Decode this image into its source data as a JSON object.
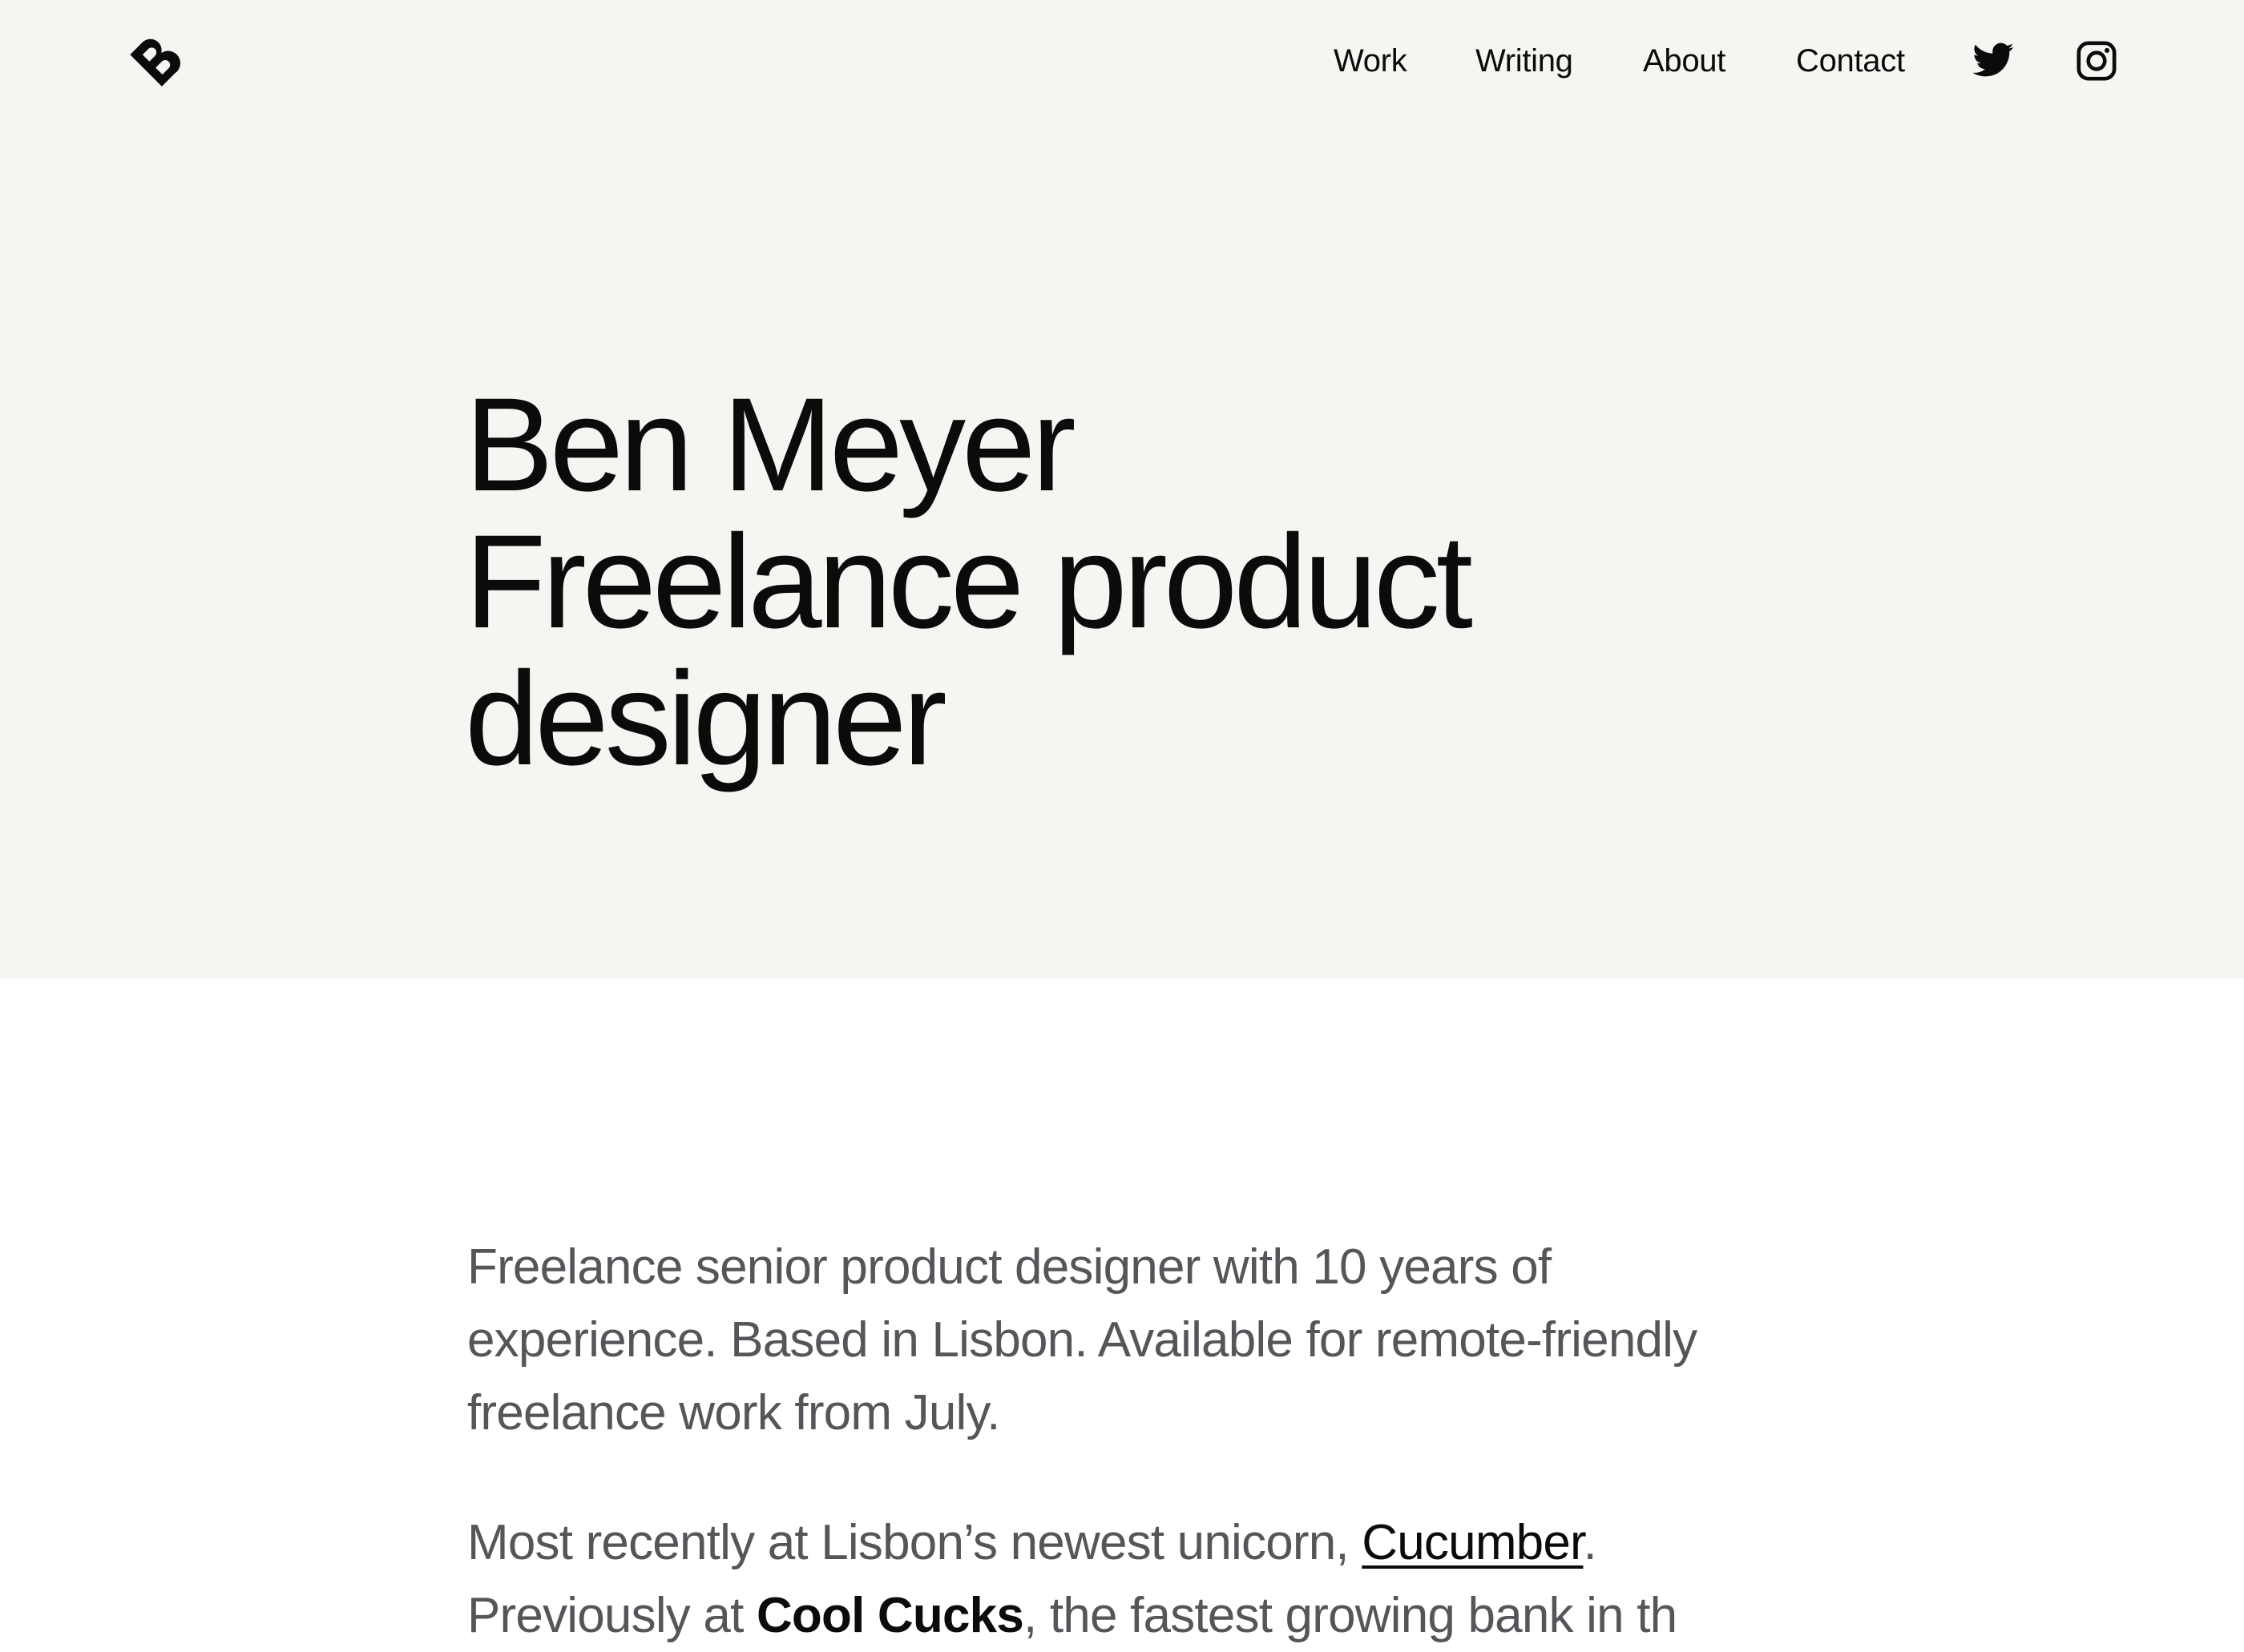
{
  "header": {
    "logo_icon": "b-monogram-icon",
    "nav": [
      {
        "label": "Work"
      },
      {
        "label": "Writing"
      },
      {
        "label": "About"
      },
      {
        "label": "Contact"
      }
    ],
    "social": [
      {
        "icon": "twitter-icon"
      },
      {
        "icon": "instagram-icon"
      }
    ]
  },
  "hero": {
    "name": "Ben Meyer",
    "title_line1": "Freelance product",
    "title_line2": "designer",
    "background": "#f5f5f2"
  },
  "intro": {
    "text": "Freelance senior product designer with 10 years of experience. Based in Lisbon. Available for remote-friendly freelance work from July."
  },
  "recent": {
    "prefix": "Most recently at Lisbon’s newest unicorn, ",
    "link": "Cucumber",
    "suffix": ".",
    "line2_prefix": "Previously at ",
    "line2_bold": "Cool Cucks",
    "line2_rest": ", the fastest growing bank in th"
  }
}
